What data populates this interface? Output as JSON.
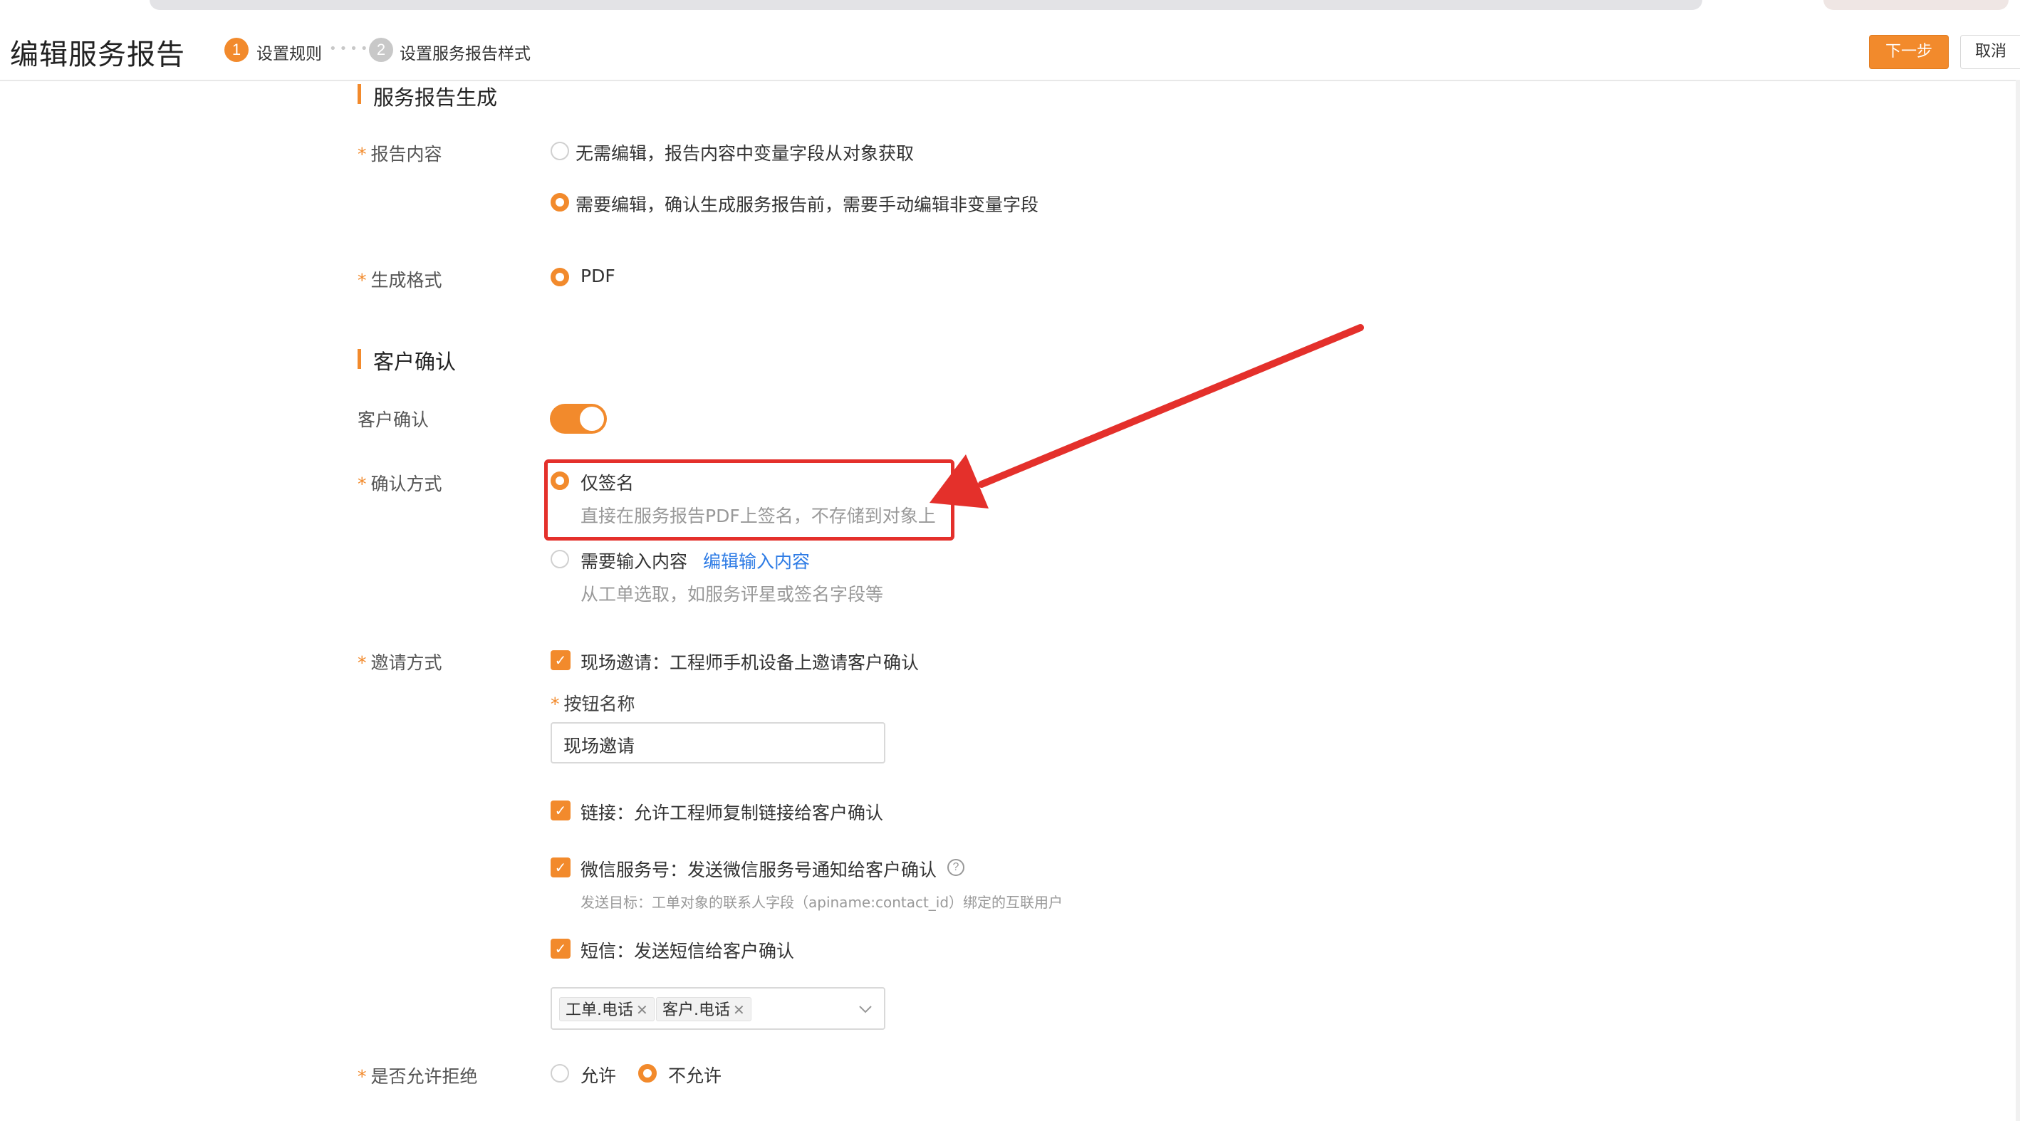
{
  "header": {
    "title": "编辑服务报告",
    "steps": [
      {
        "number": "1",
        "label": "设置规则"
      },
      {
        "number": "2",
        "label": "设置服务报告样式"
      }
    ],
    "next_label": "下一步",
    "cancel_label": "取消"
  },
  "report_section": {
    "title": "服务报告生成",
    "content_label": "报告内容",
    "content_options": [
      {
        "label": "无需编辑，报告内容中变量字段从对象获取",
        "selected": false
      },
      {
        "label": "需要编辑，确认生成服务报告前，需要手动编辑非变量字段",
        "selected": true
      }
    ],
    "format_label": "生成格式",
    "format_option": "PDF"
  },
  "confirm_section": {
    "title": "客户确认",
    "toggle_label": "客户确认",
    "toggle_on": true,
    "method_label": "确认方式",
    "method_options": [
      {
        "label": "仅签名",
        "hint": "直接在服务报告PDF上签名，不存储到对象上",
        "selected": true
      },
      {
        "label": "需要输入内容",
        "link": "编辑输入内容",
        "hint": "从工单选取，如服务评星或签名字段等",
        "selected": false
      }
    ],
    "invite_label": "邀请方式",
    "invite_options": {
      "onsite": "现场邀请：工程师手机设备上邀请客户确认",
      "button_name_label": "按钮名称",
      "button_name_value": "现场邀请",
      "link": "链接：允许工程师复制链接给客户确认",
      "wechat": "微信服务号：发送微信服务号通知给客户确认",
      "wechat_hint": "发送目标：工单对象的联系人字段（apiname:contact_id）绑定的互联用户",
      "sms": "短信：发送短信给客户确认",
      "sms_tags": [
        "工单.电话",
        "客户.电话"
      ]
    },
    "reject_label": "是否允许拒绝",
    "reject_options": [
      {
        "label": "允许",
        "selected": false
      },
      {
        "label": "不允许",
        "selected": true
      }
    ]
  },
  "colors": {
    "accent": "#f28a2c",
    "annotation": "#e4302b",
    "link": "#2d7be5"
  },
  "icons": {
    "check": "check-icon",
    "help": "help-circle-icon",
    "close": "close-icon",
    "chevron": "chevron-down-icon"
  }
}
